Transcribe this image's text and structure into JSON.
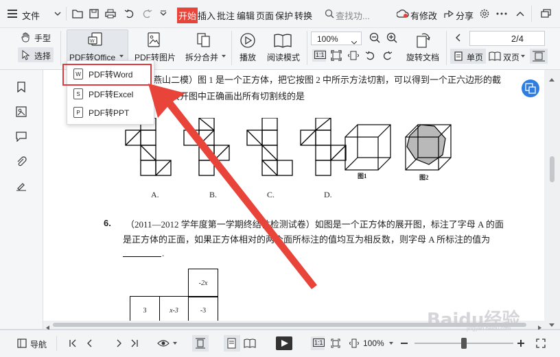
{
  "menubar": {
    "file_label": "文件",
    "tabs": [
      "开始",
      "插入",
      "批注",
      "编辑",
      "页面",
      "保护",
      "转换"
    ],
    "search_label": "查找功...",
    "modified_label": "有修改",
    "share_label": "分享"
  },
  "ribbon": {
    "hand_label": "手型",
    "select_label": "选择",
    "pdf_to_office_label": "PDF转Office",
    "pdf_to_image_label": "PDF转图片",
    "split_merge_label": "拆分合并",
    "play_label": "播放",
    "read_mode_label": "阅读模式",
    "zoom_value": "100%",
    "rotate_doc_label": "旋转文档",
    "page_value": "2/4",
    "single_page_label": "单页",
    "double_page_label": "双页"
  },
  "dropdown": {
    "items": [
      "PDF转Word",
      "PDF转Excel",
      "PDF转PPT"
    ]
  },
  "document": {
    "q5_line1": "燕山二模）图 1 是一个正方体，把它按图 2 中所示方法切割，可以得到一个正六边形的截",
    "q5_line2": "下列展开图中正确画出所有切割线的是",
    "option_labels": [
      "A.",
      "B.",
      "C.",
      "D."
    ],
    "fig1_label": "图1",
    "fig2_label": "图2",
    "q6_number": "6.",
    "q6_line1": "（2011—2012 学年度第一学期终结性检测试卷）如图是一个正方体的展开图，标注了字母 A 的面",
    "q6_line2": "是正方体的正面，如果正方体相对的两个面所标注的值均互为相反数，则字母 A 所标注的值为",
    "q6_blank_end": ".",
    "net_cells": [
      "-2x",
      "3",
      "x-3",
      "-3"
    ]
  },
  "statusbar": {
    "nav_label": "导航",
    "zoom_value": "100%"
  },
  "watermark": {
    "text": "Baidu经验",
    "url_text": "jingyan.baidu.com"
  },
  "colors": {
    "accent_red": "#e8443a",
    "tab_active_bg": "#e8443a",
    "highlight_border": "#e0383b",
    "blue_button": "#2f7de1"
  }
}
